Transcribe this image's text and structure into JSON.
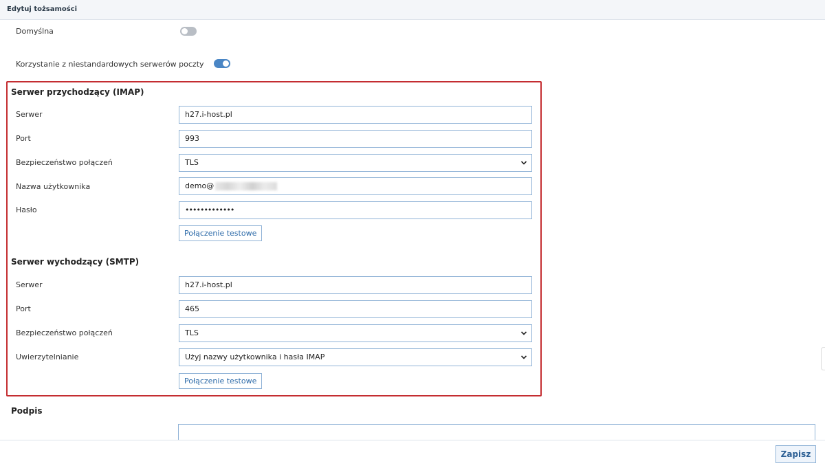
{
  "header": {
    "title": "Edytuj tożsamości"
  },
  "settings": {
    "default_label": "Domyślna",
    "default_on": false,
    "custom_servers_label": "Korzystanie z niestandardowych serwerów poczty",
    "custom_servers_on": true
  },
  "imap": {
    "title": "Serwer przychodzący (IMAP)",
    "server_label": "Serwer",
    "server_value": "h27.i-host.pl",
    "port_label": "Port",
    "port_value": "993",
    "security_label": "Bezpieczeństwo połączeń",
    "security_value": "TLS",
    "username_label": "Nazwa użytkownika",
    "username_value": "demo@",
    "password_label": "Hasło",
    "password_value": "•••••••••••••",
    "test_button": "Połączenie testowe"
  },
  "smtp": {
    "title": "Serwer wychodzący (SMTP)",
    "server_label": "Serwer",
    "server_value": "h27.i-host.pl",
    "port_label": "Port",
    "port_value": "465",
    "security_label": "Bezpieczeństwo połączeń",
    "security_value": "TLS",
    "auth_label": "Uwierzytelnianie",
    "auth_value": "Użyj nazwy użytkownika i hasła IMAP",
    "test_button": "Połączenie testowe"
  },
  "signature": {
    "title": "Podpis"
  },
  "footer": {
    "save_label": "Zapisz"
  },
  "colors": {
    "accent": "#4a86c5",
    "highlight_border": "#c42d31",
    "input_border": "#8fb2d6"
  }
}
